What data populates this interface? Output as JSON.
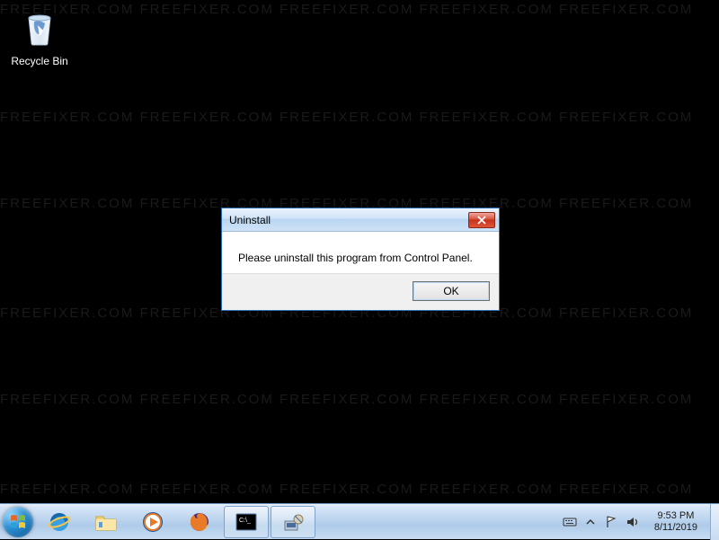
{
  "desktop": {
    "recycle_bin_label": "Recycle Bin"
  },
  "watermark": "FREEFIXER.COM   FREEFIXER.COM   FREEFIXER.COM   FREEFIXER.COM   FREEFIXER.COM",
  "dialog": {
    "title": "Uninstall",
    "message": "Please uninstall this program from Control Panel.",
    "ok_label": "OK"
  },
  "taskbar": {
    "items": [
      {
        "name": "internet-explorer"
      },
      {
        "name": "file-explorer"
      },
      {
        "name": "media-player"
      },
      {
        "name": "firefox"
      },
      {
        "name": "command-prompt",
        "active": true
      },
      {
        "name": "installer",
        "active": true
      }
    ]
  },
  "tray": {
    "time": "9:53 PM",
    "date": "8/11/2019"
  }
}
